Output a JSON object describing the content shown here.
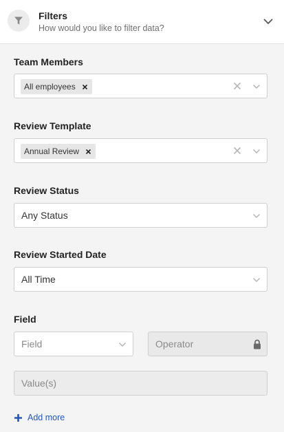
{
  "header": {
    "title": "Filters",
    "subtitle": "How would you like to filter data?"
  },
  "team_members": {
    "label": "Team Members",
    "chips": [
      "All employees"
    ]
  },
  "review_template": {
    "label": "Review Template",
    "chips": [
      "Annual Review"
    ]
  },
  "review_status": {
    "label": "Review Status",
    "value": "Any Status"
  },
  "review_started_date": {
    "label": "Review Started Date",
    "value": "All Time"
  },
  "field_section": {
    "label": "Field",
    "field_placeholder": "Field",
    "operator_placeholder": "Operator",
    "values_placeholder": "Value(s)"
  },
  "add_more": {
    "label": "Add more"
  },
  "colors": {
    "accent": "#2354c4",
    "background": "#f4f4f4"
  }
}
